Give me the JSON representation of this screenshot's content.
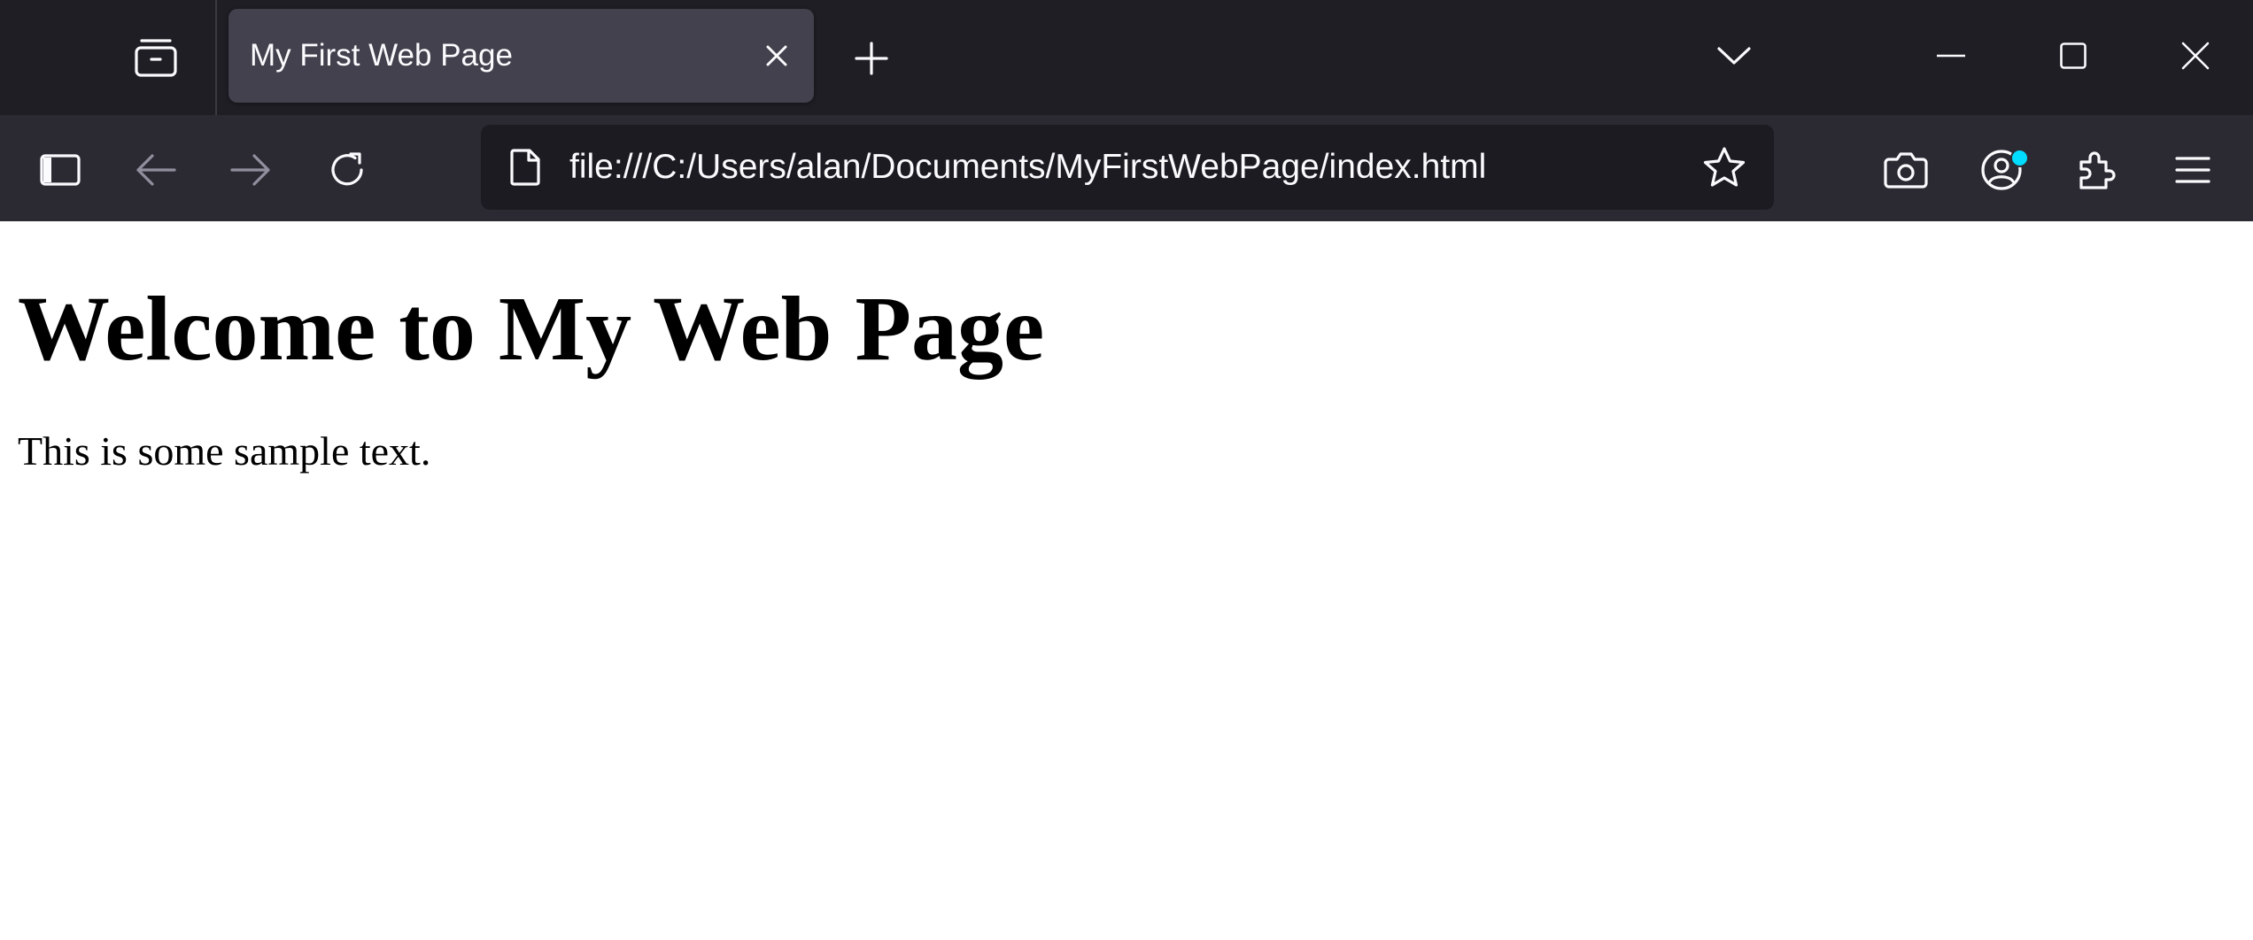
{
  "browser": {
    "tab": {
      "title": "My First Web Page"
    },
    "urlbar": {
      "url": "file:///C:/Users/alan/Documents/MyFirstWebPage/index.html"
    },
    "icons": {
      "tab_manager": "tab-manager-icon",
      "close_tab": "close-icon",
      "new_tab": "plus-icon",
      "list_all_tabs": "chevron-down-icon",
      "minimize": "minimize-icon",
      "maximize": "maximize-icon",
      "close_window": "close-icon",
      "sidebar": "sidebar-icon",
      "back": "arrow-left-icon",
      "forward": "arrow-right-icon",
      "reload": "reload-icon",
      "page": "page-icon",
      "bookmark": "star-icon",
      "screenshot": "camera-icon",
      "account": "account-icon",
      "extensions": "puzzle-icon",
      "menu": "hamburger-menu-icon"
    },
    "colors": {
      "tabstrip_bg": "#1f1e25",
      "toolbar_bg": "#2b2a33",
      "selected_tab_bg": "#42414d",
      "urlbar_bg": "#1c1b22",
      "text": "#fbfbfe",
      "account_badge": "#00ddff"
    }
  },
  "page": {
    "heading": "Welcome to My Web Page",
    "paragraph": "This is some sample text."
  }
}
